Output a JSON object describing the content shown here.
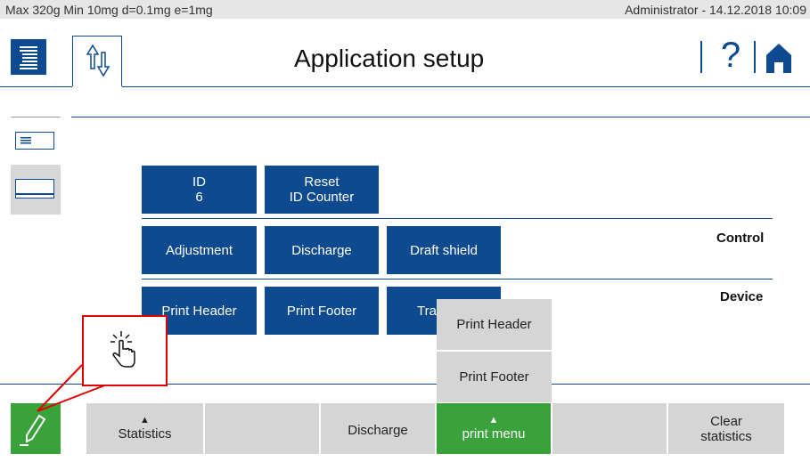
{
  "status": {
    "left": "Max 320g  Min 10mg  d=0.1mg  e=1mg",
    "right": "Administrator  -  14.12.2018 10:09"
  },
  "header": {
    "title": "Application setup",
    "menu_icon": "menu-list-icon",
    "tab_icon": "up-down-arrows-icon",
    "help_label": "?",
    "home_icon": "home-icon"
  },
  "sidebar": {
    "items": [
      {
        "icon": "small-screen-icon"
      },
      {
        "icon": "large-screen-icon",
        "selected": true
      }
    ]
  },
  "buttons_top": [
    {
      "line1": "ID",
      "line2": "6"
    },
    {
      "line1": "Reset",
      "line2": "ID Counter"
    }
  ],
  "control": {
    "label": "Control",
    "buttons": [
      "Adjustment",
      "Discharge",
      "Draft shield"
    ]
  },
  "device": {
    "label": "Device",
    "buttons": [
      "Print Header",
      "Print Footer",
      "Tra"
    ]
  },
  "popup_menu": {
    "items": [
      "Print Header",
      "Print Footer"
    ]
  },
  "bottom_bar": {
    "edit_icon": "pencil-icon",
    "statistics": "Statistics",
    "discharge": "Discharge",
    "print_menu": "print menu",
    "clear_line1": "Clear",
    "clear_line2": "statistics"
  },
  "callout": {
    "icon": "hand-tap-icon"
  },
  "colors": {
    "accent_blue": "#0d4a8f",
    "green": "#3aa23a",
    "gray_button": "#d5d5d5",
    "status_bar": "#e6e6e6",
    "callout_red": "#e00000"
  }
}
